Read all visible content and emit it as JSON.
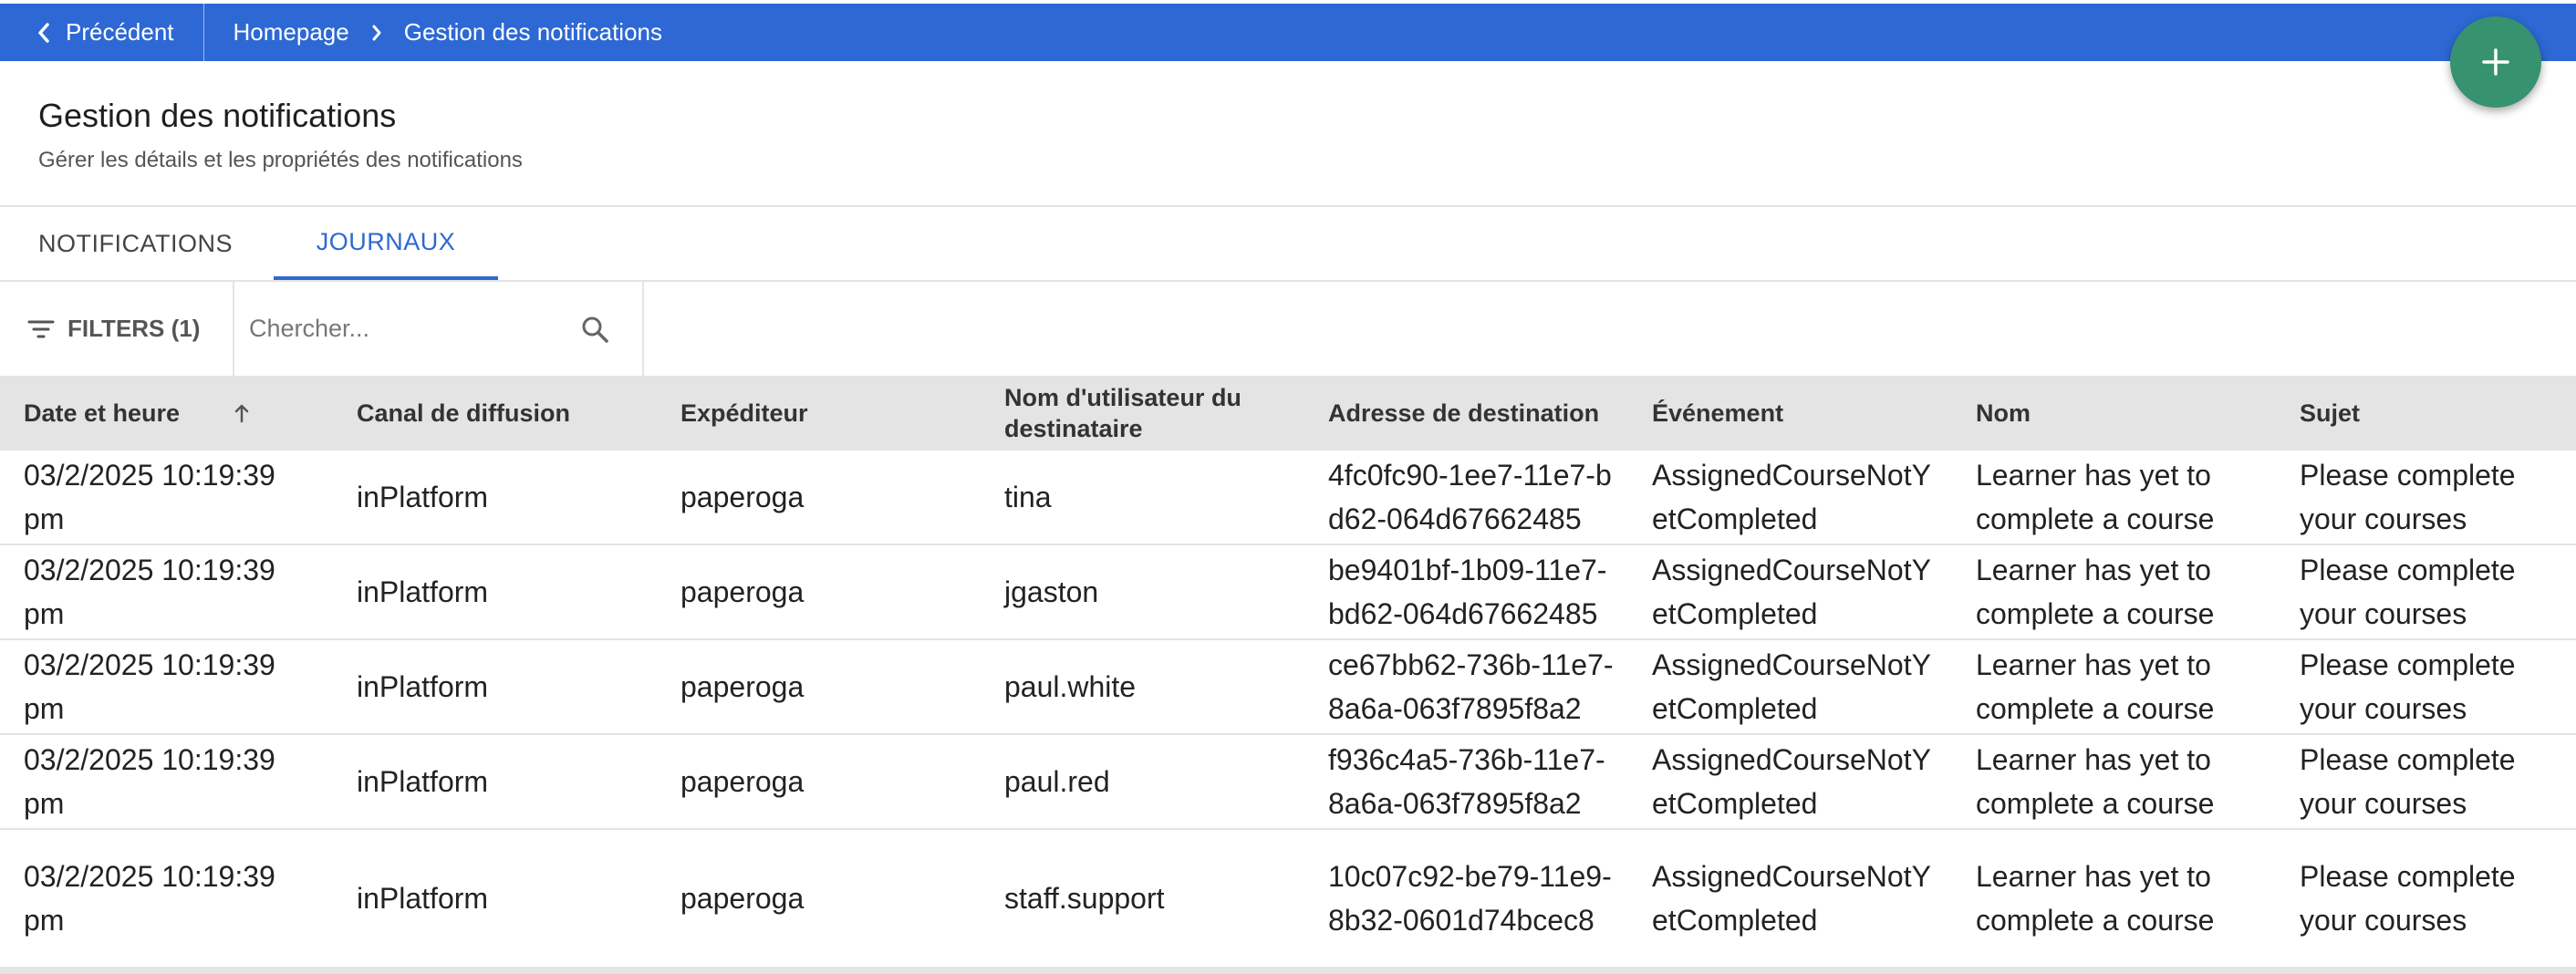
{
  "topbar": {
    "back_label": "Précédent",
    "breadcrumb": [
      "Homepage",
      "Gestion des notifications"
    ]
  },
  "header": {
    "title": "Gestion des notifications",
    "subtitle": "Gérer les détails et les propriétés des notifications"
  },
  "tabs": [
    {
      "label": "NOTIFICATIONS",
      "active": false
    },
    {
      "label": "JOURNAUX",
      "active": true
    }
  ],
  "toolbar": {
    "filters_label": "FILTERS (1)",
    "search_placeholder": "Chercher..."
  },
  "table": {
    "columns": [
      "Date et heure",
      "Canal de diffusion",
      "Expéditeur",
      "Nom d'utilisateur du destinataire",
      "Adresse de destination",
      "Événement",
      "Nom",
      "Sujet"
    ],
    "rows": [
      [
        "03/2/2025 10:19:39 pm",
        "inPlatform",
        "paperoga",
        "tina",
        "4fc0fc90-1ee7-11e7-bd62-064d67662485",
        "AssignedCourseNotYetCompleted",
        "Learner has yet to complete a course",
        "Please complete your courses"
      ],
      [
        "03/2/2025 10:19:39 pm",
        "inPlatform",
        "paperoga",
        "jgaston",
        "be9401bf-1b09-11e7-bd62-064d67662485",
        "AssignedCourseNotYetCompleted",
        "Learner has yet to complete a course",
        "Please complete your courses"
      ],
      [
        "03/2/2025 10:19:39 pm",
        "inPlatform",
        "paperoga",
        "paul.white",
        "ce67bb62-736b-11e7-8a6a-063f7895f8a2",
        "AssignedCourseNotYetCompleted",
        "Learner has yet to complete a course",
        "Please complete your courses"
      ],
      [
        "03/2/2025 10:19:39 pm",
        "inPlatform",
        "paperoga",
        "paul.red",
        "f936c4a5-736b-11e7-8a6a-063f7895f8a2",
        "AssignedCourseNotYetCompleted",
        "Learner has yet to complete a course",
        "Please complete your courses"
      ],
      [
        "03/2/2025 10:19:39 pm",
        "inPlatform",
        "paperoga",
        "staff.support",
        "10c07c92-be79-11e9-8b32-0601d74bcec8",
        "AssignedCourseNotYetCompleted",
        "Learner has yet to complete a course",
        "Please complete your courses"
      ]
    ]
  },
  "colors": {
    "topbar": "#2d68d4",
    "fab": "#36926f",
    "active_tab": "#2d68d4",
    "table_header": "#e4e4e4"
  },
  "icons": {
    "back": "chevron-left-icon",
    "breadcrumb_separator": "chevron-right-icon",
    "fab": "plus-icon",
    "filters": "filter-list-icon",
    "search": "search-icon",
    "sort": "arrow-up-icon"
  }
}
